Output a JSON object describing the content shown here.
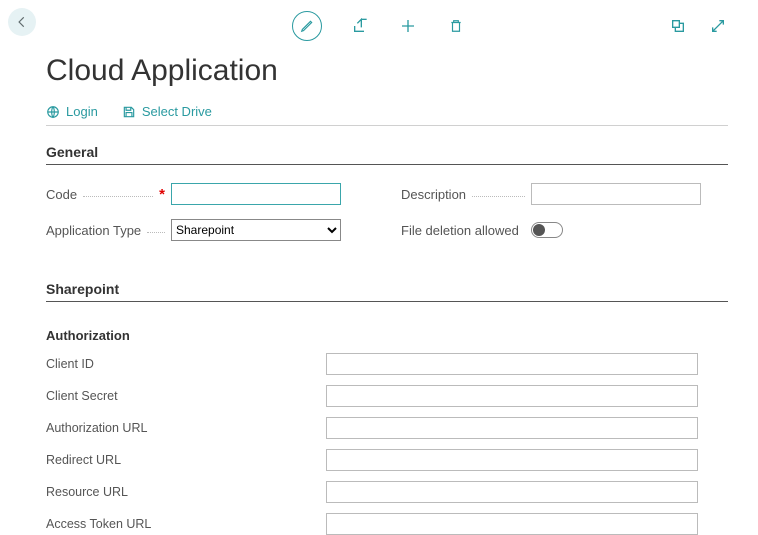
{
  "header": {
    "title": "Cloud Application"
  },
  "links": {
    "login": "Login",
    "select_drive": "Select Drive"
  },
  "sections": {
    "general": "General",
    "sharepoint": "Sharepoint",
    "authorization": "Authorization"
  },
  "fields": {
    "code_label": "Code",
    "code_value": "",
    "description_label": "Description",
    "description_value": "",
    "app_type_label": "Application Type",
    "app_type_value": "Sharepoint",
    "file_del_label": "File deletion allowed"
  },
  "auth": {
    "client_id_label": "Client ID",
    "client_id_value": "",
    "client_secret_label": "Client Secret",
    "client_secret_value": "",
    "auth_url_label": "Authorization URL",
    "auth_url_value": "",
    "redirect_url_label": "Redirect URL",
    "redirect_url_value": "",
    "resource_url_label": "Resource URL",
    "resource_url_value": "",
    "access_token_url_label": "Access Token URL",
    "access_token_url_value": ""
  }
}
